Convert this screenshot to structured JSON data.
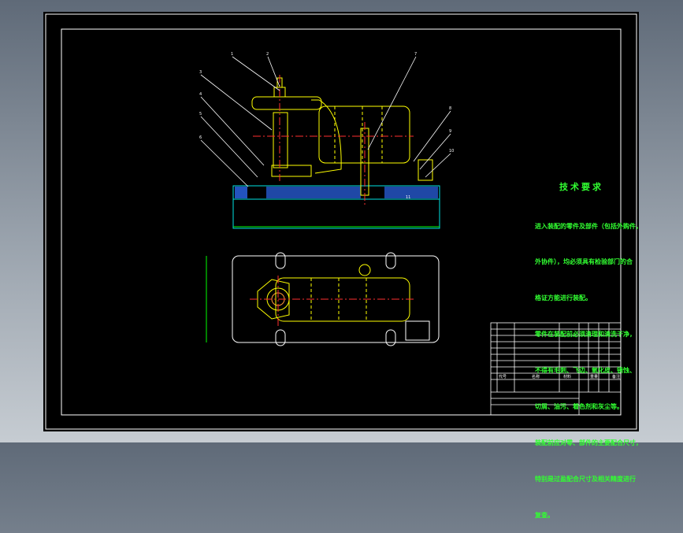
{
  "tech_requirements": {
    "title": "技术要求",
    "lines": [
      "进入装配的零件及部件（包括外购件，",
      "外协件），均必须具有检验部门的合",
      "格证方能进行装配。",
      "零件在装配前必须清理和清洗干净，",
      "不得有毛刺、飞边、氧化皮、锈蚀、",
      "切屑、油污、着色剂和灰尘等。",
      "装配前应对零、部件的主要配合尺寸，",
      "特别是过盈配合尺寸及相关精度进行",
      "复查。"
    ]
  },
  "title_block": {
    "headers": [
      "代号",
      "名称",
      "材料",
      "重量",
      "备注"
    ],
    "unreadable_rows": 10
  },
  "balloons": [
    "1",
    "2",
    "3",
    "4",
    "5",
    "6",
    "7",
    "8",
    "9",
    "10",
    "11"
  ],
  "colors": {
    "background": "#000000",
    "frame": "#ffffff",
    "part_outline": "#ffff00",
    "centerline": "#ff3030",
    "hatch": "#2f6fff",
    "dimension": "#00ff00",
    "base": "#00e5e5",
    "text": "#31ff31"
  }
}
